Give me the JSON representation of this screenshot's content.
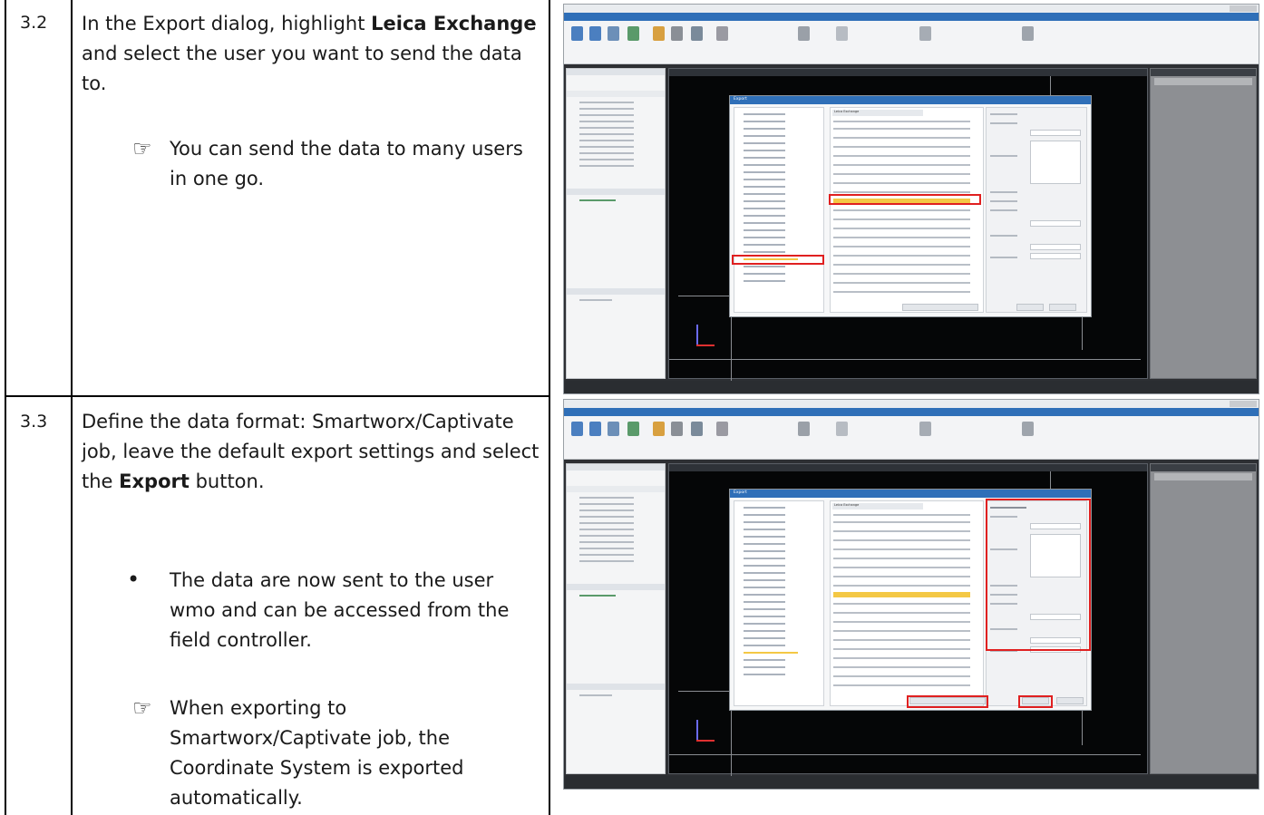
{
  "rows": [
    {
      "step": "3.2",
      "text_parts": [
        {
          "t": "In the Export dialog, highlight ",
          "b": false
        },
        {
          "t": "Leica Exchange",
          "b": true
        },
        {
          "t": " and select the user you want to send the data to.",
          "b": false
        }
      ],
      "note_icon": "pointing-hand-icon",
      "note": "You can send the data to many users in one go.",
      "screenshot": {
        "dialog_title": "Export",
        "list_header": "Leica Exchange",
        "highlighted_tree_item": "Leica Exchange",
        "highlighted_user": "wmo"
      }
    },
    {
      "step": "3.3",
      "text_parts": [
        {
          "t": "Define the data format: Smartworx/Captivate job, leave the default export settings and select the ",
          "b": false
        },
        {
          "t": "Export",
          "b": true
        },
        {
          "t": " button.",
          "b": false
        }
      ],
      "bullet": "The data are now sent to the user wmo and can be accessed from the field controller.",
      "note_icon": "pointing-hand-icon",
      "note": "When exporting to Smartworx/Captivate job, the Coordinate System is exported automatically.",
      "screenshot": {
        "dialog_title": "Export",
        "list_header": "Leica Exchange",
        "settings_header": "Export Settings"
      }
    }
  ],
  "colors": {
    "highlight": "#e02020",
    "selection": "#f4c845",
    "app_accent": "#2f6fb8"
  }
}
